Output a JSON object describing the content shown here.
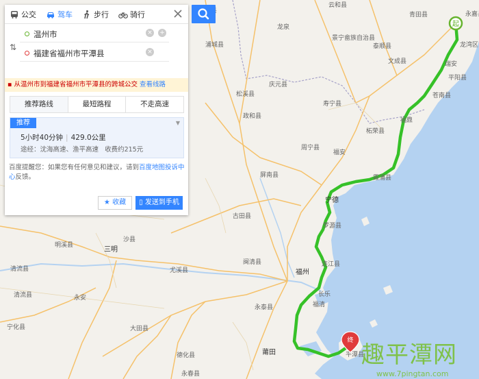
{
  "tabs": [
    {
      "label": "公交",
      "icon": "bus-icon",
      "active": false
    },
    {
      "label": "驾车",
      "icon": "car-icon",
      "active": true
    },
    {
      "label": "步行",
      "icon": "walk-icon",
      "active": false
    },
    {
      "label": "骑行",
      "icon": "bike-icon",
      "active": false
    }
  ],
  "inputs": {
    "start": "温州市",
    "end": "福建省福州市平潭县"
  },
  "notice": {
    "text": "从温州市到福建省福州市平潭县的跨城公交",
    "link": "查看线路"
  },
  "options": [
    "推荐路线",
    "最短路程",
    "不走高速"
  ],
  "route": {
    "badge": "推荐",
    "duration": "5小时40分钟",
    "distance": "429.0公里",
    "via": "途经：沈海高速、渔平高速",
    "fee": "收费约215元"
  },
  "tip": {
    "prefix": "百度提醒您：如果您有任何意见和建议，请到",
    "link": "百度地图投诉中心",
    "suffix": "反馈。"
  },
  "buttons": {
    "favorite": "收藏",
    "send": "发送到手机"
  },
  "map": {
    "start_marker": "起",
    "end_marker": "终",
    "places": [
      {
        "name": "庆元县"
      },
      {
        "name": "云和县"
      },
      {
        "name": "景宁畲族自治县"
      },
      {
        "name": "青田县"
      },
      {
        "name": "永嘉县"
      },
      {
        "name": "龙泉"
      },
      {
        "name": "泰顺县"
      },
      {
        "name": "龙湾区"
      },
      {
        "name": "文成县"
      },
      {
        "name": "瑞安"
      },
      {
        "name": "松溪县"
      },
      {
        "name": "庆元县"
      },
      {
        "name": "平阳县"
      },
      {
        "name": "苍南县"
      },
      {
        "name": "政和县"
      },
      {
        "name": "寿宁县"
      },
      {
        "name": "福鼎"
      },
      {
        "name": "柘荣县"
      },
      {
        "name": "周宁县"
      },
      {
        "name": "福安"
      },
      {
        "name": "霞浦县"
      },
      {
        "name": "屏南县"
      },
      {
        "name": "宁德"
      },
      {
        "name": "古田县"
      },
      {
        "name": "罗源县"
      },
      {
        "name": "明溪县"
      },
      {
        "name": "三明"
      },
      {
        "name": "沙县"
      },
      {
        "name": "闽清县"
      },
      {
        "name": "连江县"
      },
      {
        "name": "福州"
      },
      {
        "name": "尤溪县"
      },
      {
        "name": "清流县"
      },
      {
        "name": "长乐"
      },
      {
        "name": "永安"
      },
      {
        "name": "永泰县"
      },
      {
        "name": "福清"
      },
      {
        "name": "大田县"
      },
      {
        "name": "德化县"
      },
      {
        "name": "莆田"
      },
      {
        "name": "永春县"
      },
      {
        "name": "宁化县"
      },
      {
        "name": "清流县"
      },
      {
        "name": "平潭县"
      },
      {
        "name": "浦城县"
      }
    ]
  },
  "watermark": {
    "text": "趣平潭网",
    "url": "www.7pingtan.com"
  },
  "colors": {
    "accent": "#3385ff",
    "route": "#36c128",
    "start": "#66b32e",
    "end": "#e03b3b",
    "sea": "#b4d2f1",
    "land": "#f3f1ec",
    "road": "#f5c16a"
  }
}
